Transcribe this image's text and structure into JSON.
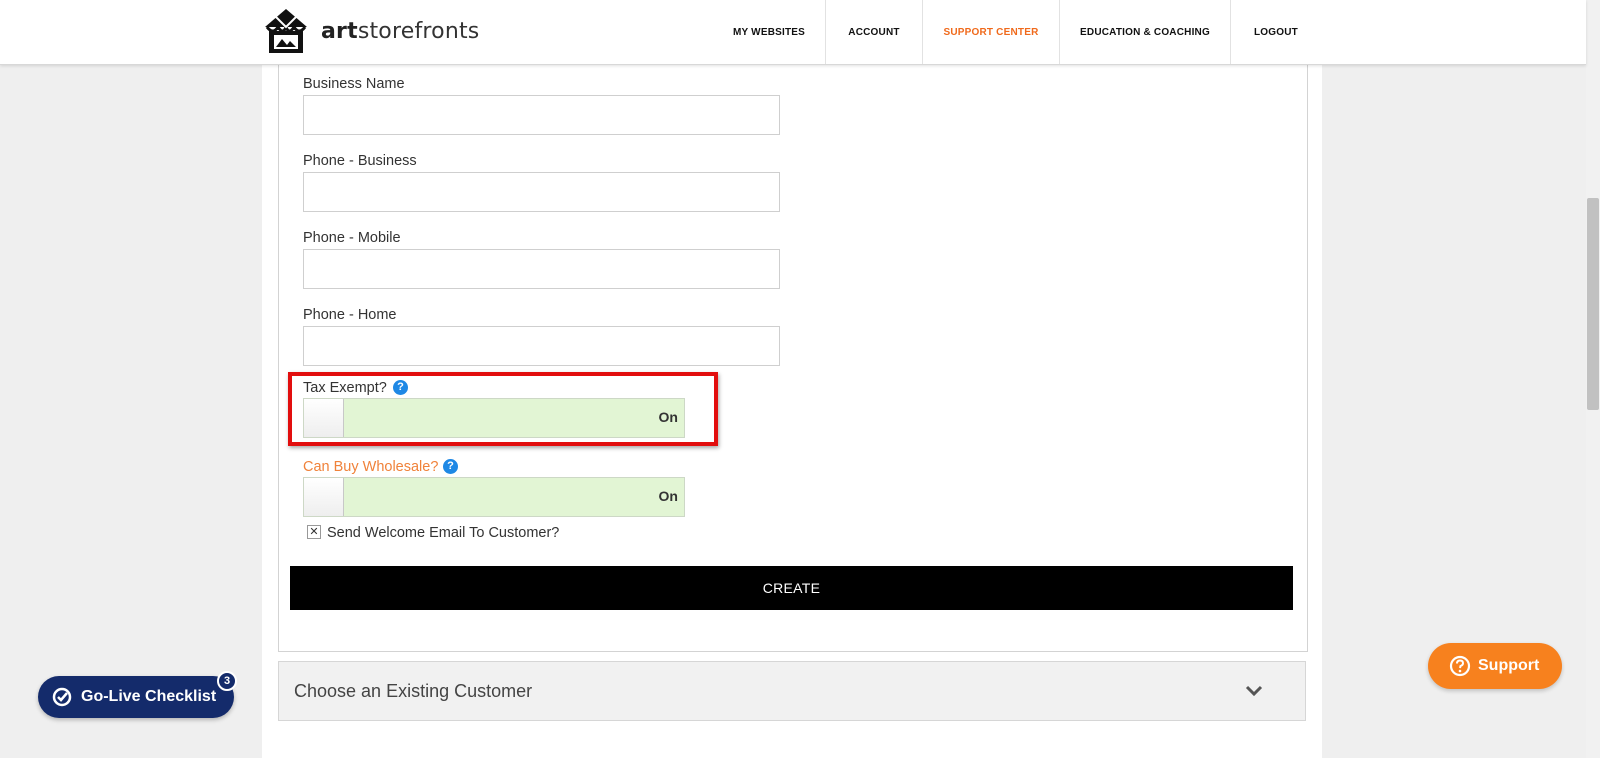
{
  "header": {
    "logo_bold": "art",
    "logo_rest": "storefronts",
    "nav": [
      {
        "label": "MY WEBSITES"
      },
      {
        "label": "ACCOUNT"
      },
      {
        "label": "SUPPORT CENTER"
      },
      {
        "label": "EDUCATION & COACHING"
      },
      {
        "label": "LOGOUT"
      }
    ],
    "active_color": "#f06a1c"
  },
  "form": {
    "business_name": {
      "label": "Business Name",
      "value": ""
    },
    "phone_business": {
      "label": "Phone - Business",
      "value": ""
    },
    "phone_mobile": {
      "label": "Phone - Mobile",
      "value": ""
    },
    "phone_home": {
      "label": "Phone - Home",
      "value": ""
    },
    "tax_exempt": {
      "label": "Tax Exempt?",
      "help": "?",
      "state": "On"
    },
    "can_buy_wholesale": {
      "label": "Can Buy Wholesale?",
      "help": "?",
      "state": "On"
    },
    "welcome_email": {
      "label": "Send Welcome Email To Customer?",
      "mark": "✕"
    },
    "create_label": "CREATE"
  },
  "existing_customer": {
    "title": "Choose an Existing Customer"
  },
  "go_live": {
    "label": "Go-Live Checklist",
    "badge": "3"
  },
  "support": {
    "label": "Support"
  },
  "colors": {
    "toggle_on": "#e2f5d4",
    "highlight": "#e20e0e",
    "go_live_bg": "#142b6b",
    "support_bg": "#f7811e",
    "help_icon": "#1e88e5"
  }
}
